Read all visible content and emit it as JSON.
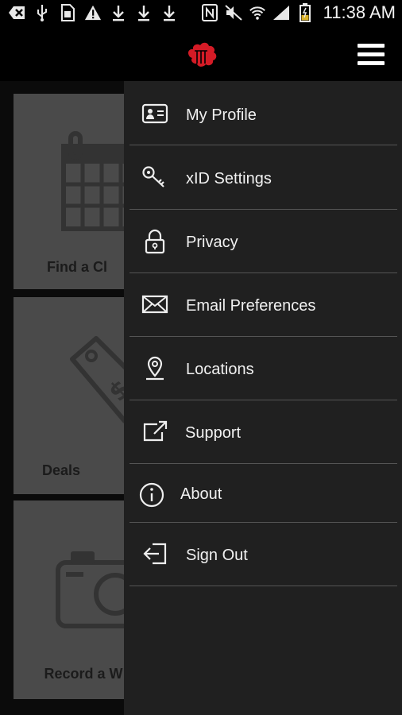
{
  "status_bar": {
    "time": "11:38 AM",
    "left_icons": [
      "back-arrow-icon",
      "usb-icon",
      "sim-card-icon",
      "warning-icon",
      "download-icon",
      "download-icon",
      "download-icon"
    ],
    "right_icons": [
      "nfc-icon",
      "mute-icon",
      "wifi-icon",
      "signal-icon",
      "battery-icon"
    ]
  },
  "app_bar": {
    "logo": "red-logo",
    "menu_icon": "hamburger-menu-icon"
  },
  "tiles": [
    {
      "label": "Find a Cl",
      "icon": "calendar-icon"
    },
    {
      "label": "Deals",
      "icon": "price-tag-icon"
    },
    {
      "label": "Record a W",
      "icon": "camera-icon"
    }
  ],
  "menu": {
    "items": [
      {
        "label": "My Profile",
        "icon": "profile-card-icon"
      },
      {
        "label": "xID Settings",
        "icon": "key-icon"
      },
      {
        "label": "Privacy",
        "icon": "lock-icon"
      },
      {
        "label": "Email Preferences",
        "icon": "envelope-icon"
      },
      {
        "label": "Locations",
        "icon": "location-pin-icon"
      },
      {
        "label": "Support",
        "icon": "external-link-icon"
      },
      {
        "label": "About",
        "icon": "info-icon"
      },
      {
        "label": "Sign Out",
        "icon": "sign-out-icon"
      }
    ]
  },
  "colors": {
    "drawer_bg": "#202020",
    "tile_bg": "#4a4a4a",
    "logo_red": "#d41b26",
    "divider": "#555555"
  }
}
